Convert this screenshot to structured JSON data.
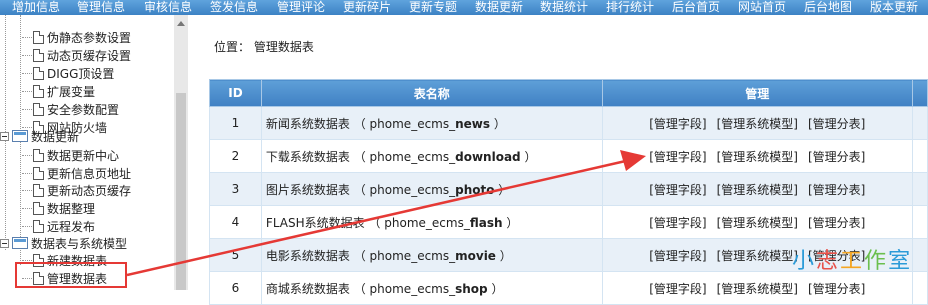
{
  "top_menu": [
    "增加信息",
    "管理信息",
    "审核信息",
    "签发信息",
    "管理评论",
    "更新碎片",
    "更新专题",
    "数据更新",
    "数据统计",
    "排行统计",
    "后台首页",
    "网站首页",
    "后台地图",
    "版本更新"
  ],
  "sidebar": {
    "group1_items": [
      "伪静态参数设置",
      "动态页缓存设置",
      "DIGG顶设置",
      "扩展变量",
      "安全参数配置",
      "网站防火墙"
    ],
    "group2_title": "数据更新",
    "group2_items": [
      "数据更新中心",
      "更新信息页地址",
      "更新动态页缓存",
      "数据整理",
      "远程发布"
    ],
    "group3_title": "数据表与系统模型",
    "group3_items": [
      "新建数据表",
      "管理数据表"
    ]
  },
  "breadcrumb": {
    "prefix": "位置：",
    "current": "管理数据表"
  },
  "table": {
    "headers": [
      "ID",
      "表名称",
      "管理"
    ],
    "rows": [
      {
        "id": "1",
        "name": "新闻系统数据表",
        "code": "news"
      },
      {
        "id": "2",
        "name": "下载系统数据表",
        "code": "download"
      },
      {
        "id": "3",
        "name": "图片系统数据表",
        "code": "photo"
      },
      {
        "id": "4",
        "name": "FLASH系统数据表",
        "code": "flash"
      },
      {
        "id": "5",
        "name": "电影系统数据表",
        "code": "movie"
      },
      {
        "id": "6",
        "name": "商城系统数据表",
        "code": "shop"
      }
    ],
    "code_prefix": "phome_ecms_",
    "actions": [
      "[管理字段]",
      "[管理系统模型]",
      "[管理分表]"
    ]
  },
  "watermark": {
    "chars": [
      "小",
      "志",
      "工",
      "作",
      "室"
    ],
    "colors": [
      "#2b9bd8",
      "#e8524a",
      "#f5a623",
      "#6bbf4e",
      "#2b9bd8"
    ]
  },
  "colors": {
    "accent": "#3f80c3",
    "highlight": "#e53935"
  }
}
